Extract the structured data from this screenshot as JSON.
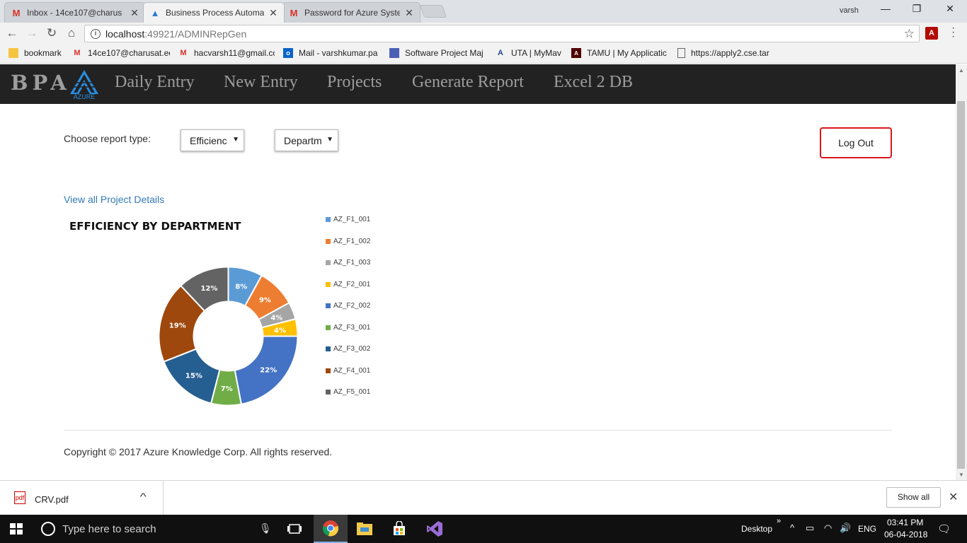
{
  "browser": {
    "tabs": [
      {
        "title": "Inbox - 14ce107@charus",
        "icon": "gmail-icon",
        "active": false
      },
      {
        "title": "Business Process Automa",
        "icon": "azure-icon",
        "active": true
      },
      {
        "title": "Password for Azure Syste",
        "icon": "gmail-icon",
        "active": false
      }
    ],
    "tab_close": "✕",
    "user": "varsh",
    "url_host": "localhost",
    "url_path": ":49921/ADMINRepGen",
    "bookmarks": [
      {
        "label": "bookmark",
        "icon": "folder-icon"
      },
      {
        "label": "14ce107@charusat.ec",
        "icon": "gmail-icon"
      },
      {
        "label": "hacvarsh11@gmail.co",
        "icon": "gmail-icon"
      },
      {
        "label": "Mail - varshkumar.pa",
        "icon": "outlook-icon"
      },
      {
        "label": "Software Project Maj",
        "icon": "form-icon"
      },
      {
        "label": "UTA | MyMav",
        "icon": "uta-icon"
      },
      {
        "label": "TAMU | My Applicatic",
        "icon": "tamu-icon"
      },
      {
        "label": "https://apply2.cse.tar",
        "icon": "page-icon"
      }
    ]
  },
  "app": {
    "brand": "BPA",
    "logo_text": "AZURE",
    "nav": [
      "Daily Entry",
      "New Entry",
      "Projects",
      "Generate Report",
      "Excel 2 DB"
    ],
    "report_label": "Choose report type:",
    "select_report": "Efficienc",
    "select_group": "Departm",
    "logout": "Log Out",
    "view_link": "View all Project Details",
    "copyright": "Copyright © 2017 Azure Knowledge Corp. All rights reserved."
  },
  "chart_data": {
    "type": "pie",
    "variant": "donut",
    "title": "EFFICIENCY BY DEPARTMENT",
    "legend_position": "right",
    "series": [
      {
        "name": "AZ_F1_001",
        "value": 8,
        "label": "8%",
        "color": "#5b9bd5"
      },
      {
        "name": "AZ_F1_002",
        "value": 9,
        "label": "9%",
        "color": "#ed7d31"
      },
      {
        "name": "AZ_F1_003",
        "value": 4,
        "label": "4%",
        "color": "#a5a5a5"
      },
      {
        "name": "AZ_F2_001",
        "value": 4,
        "label": "4%",
        "color": "#ffc000"
      },
      {
        "name": "AZ_F2_002",
        "value": 22,
        "label": "22%",
        "color": "#4472c4"
      },
      {
        "name": "AZ_F3_001",
        "value": 7,
        "label": "7%",
        "color": "#70ad47"
      },
      {
        "name": "AZ_F3_002",
        "value": 15,
        "label": "15%",
        "color": "#255e91"
      },
      {
        "name": "AZ_F4_001",
        "value": 19,
        "label": "19%",
        "color": "#9e480e"
      },
      {
        "name": "AZ_F5_001",
        "value": 12,
        "label": "12%",
        "color": "#636363"
      }
    ]
  },
  "downloads": {
    "file": "CRV.pdf",
    "show_all": "Show all"
  },
  "taskbar": {
    "search": "Type here to search",
    "desktop": "Desktop",
    "lang": "ENG",
    "time": "03:41 PM",
    "date": "06-04-2018"
  }
}
